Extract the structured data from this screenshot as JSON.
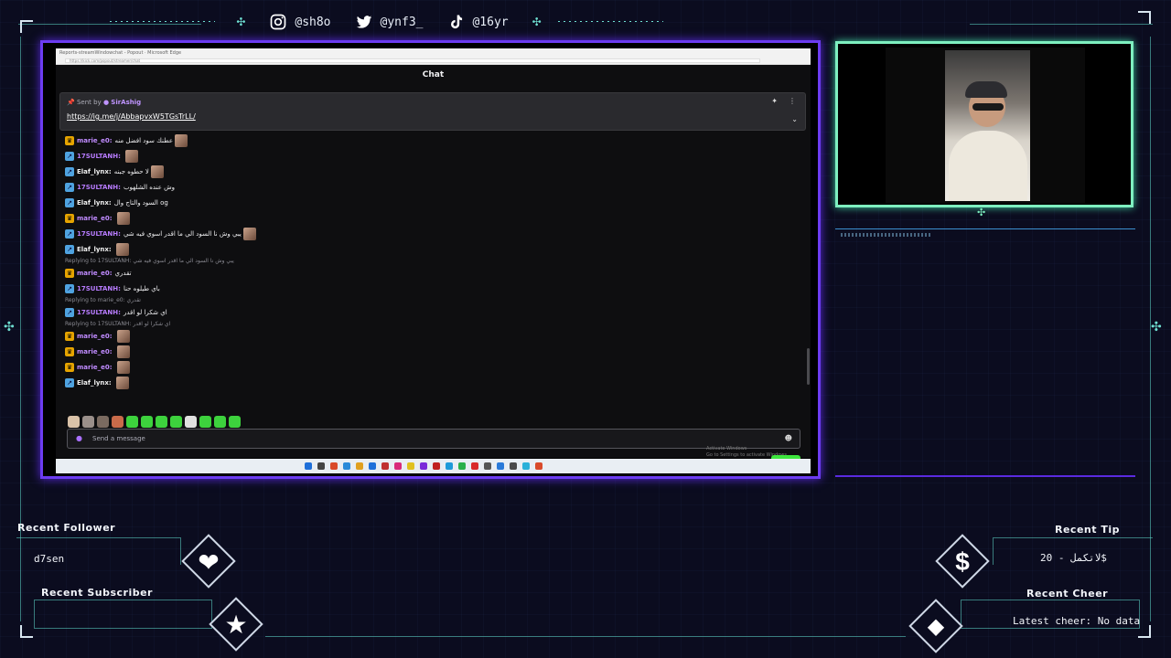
{
  "social": {
    "instagram": "@sh8o",
    "twitter": "@ynf3_",
    "tiktok": "@16yr"
  },
  "browser": {
    "tab_text": "Reports-streamWindowchat - Popout · Microsoft Edge",
    "url": "https://kick.com/popout/streamer/chat"
  },
  "chat": {
    "title": "Chat",
    "pinned": {
      "sent_by_prefix": "Sent by",
      "sent_by_user": "SirAshig",
      "link": "https://ig.me/j/AbbapvxW5TGsTrLL/"
    },
    "messages": [
      {
        "type": "msg",
        "badge": "crown",
        "user": "marie_e0:",
        "color": "#c08bff",
        "text": "عطنك سود افضل منه",
        "thumb": true
      },
      {
        "type": "msg",
        "badge": "sub",
        "user": "17SULTANH:",
        "color": "#b87cff",
        "text": "",
        "thumb": true
      },
      {
        "type": "msg",
        "badge": "sub",
        "user": "Elaf_lynx:",
        "color": "#f0f0f0",
        "text": "لا حطوه جبنه",
        "thumb": true
      },
      {
        "type": "msg",
        "badge": "sub",
        "user": "17SULTANH:",
        "color": "#b87cff",
        "text": "وش عنده الشلهوب",
        "thumb": false
      },
      {
        "type": "msg",
        "badge": "sub",
        "user": "Elaf_lynx:",
        "color": "#f0f0f0",
        "text": "السود والتاج وال og",
        "thumb": false
      },
      {
        "type": "msg",
        "badge": "crown",
        "user": "marie_e0:",
        "color": "#c08bff",
        "text": "",
        "thumb": true
      },
      {
        "type": "msg",
        "badge": "sub",
        "user": "17SULTANH:",
        "color": "#b87cff",
        "text": "يبي وش نا السود الي ما اقدر اسوي فيه شي",
        "thumb": true
      },
      {
        "type": "msg",
        "badge": "sub",
        "user": "Elaf_lynx:",
        "color": "#f0f0f0",
        "text": "",
        "thumb": true
      },
      {
        "type": "reply",
        "text": "Replying to 17SULTANH: يبي وش نا السود الي ما اقدر اسوي فيه شي"
      },
      {
        "type": "msg",
        "badge": "crown",
        "user": "marie_e0:",
        "color": "#c08bff",
        "text": "تقدري",
        "thumb": false
      },
      {
        "type": "msg",
        "badge": "sub",
        "user": "17SULTANH:",
        "color": "#b87cff",
        "text": "باي طيلوه حنا",
        "thumb": false
      },
      {
        "type": "reply",
        "text": "Replying to marie_e0: تقدري"
      },
      {
        "type": "msg",
        "badge": "sub",
        "user": "17SULTANH:",
        "color": "#b87cff",
        "text": "اي شكرا لو اقدر",
        "thumb": false
      },
      {
        "type": "reply",
        "text": "Replying to 17SULTANH: اي شكرا لو اقدر"
      },
      {
        "type": "msg",
        "badge": "crown",
        "user": "marie_e0:",
        "color": "#c08bff",
        "text": "",
        "thumb": true
      },
      {
        "type": "msg",
        "badge": "crown",
        "user": "marie_e0:",
        "color": "#c08bff",
        "text": "",
        "thumb": true
      },
      {
        "type": "msg",
        "badge": "crown",
        "user": "marie_e0:",
        "color": "#c08bff",
        "text": "",
        "thumb": true
      },
      {
        "type": "msg",
        "badge": "sub",
        "user": "Elaf_lynx:",
        "color": "#f0f0f0",
        "text": "",
        "thumb": true
      }
    ],
    "input_placeholder": "Send a message",
    "send_button": "Chat",
    "activate_line1": "Activate Windows",
    "activate_line2": "Go to Settings to activate Windows."
  },
  "widgets": {
    "recent_follower_label": "Recent Follower",
    "recent_follower_value": "d7sen",
    "recent_subscriber_label": "Recent Subscriber",
    "recent_tip_label": "Recent Tip",
    "recent_tip_value": "لاتكمل - 20$",
    "recent_cheer_label": "Recent Cheer",
    "recent_cheer_value": "Latest cheer: No data"
  },
  "colors": {
    "screen_border": "#6c3cf0",
    "cam_border": "#7ef0c0",
    "chat_send": "#3de63d",
    "accent_line": "#5fd7c8"
  }
}
